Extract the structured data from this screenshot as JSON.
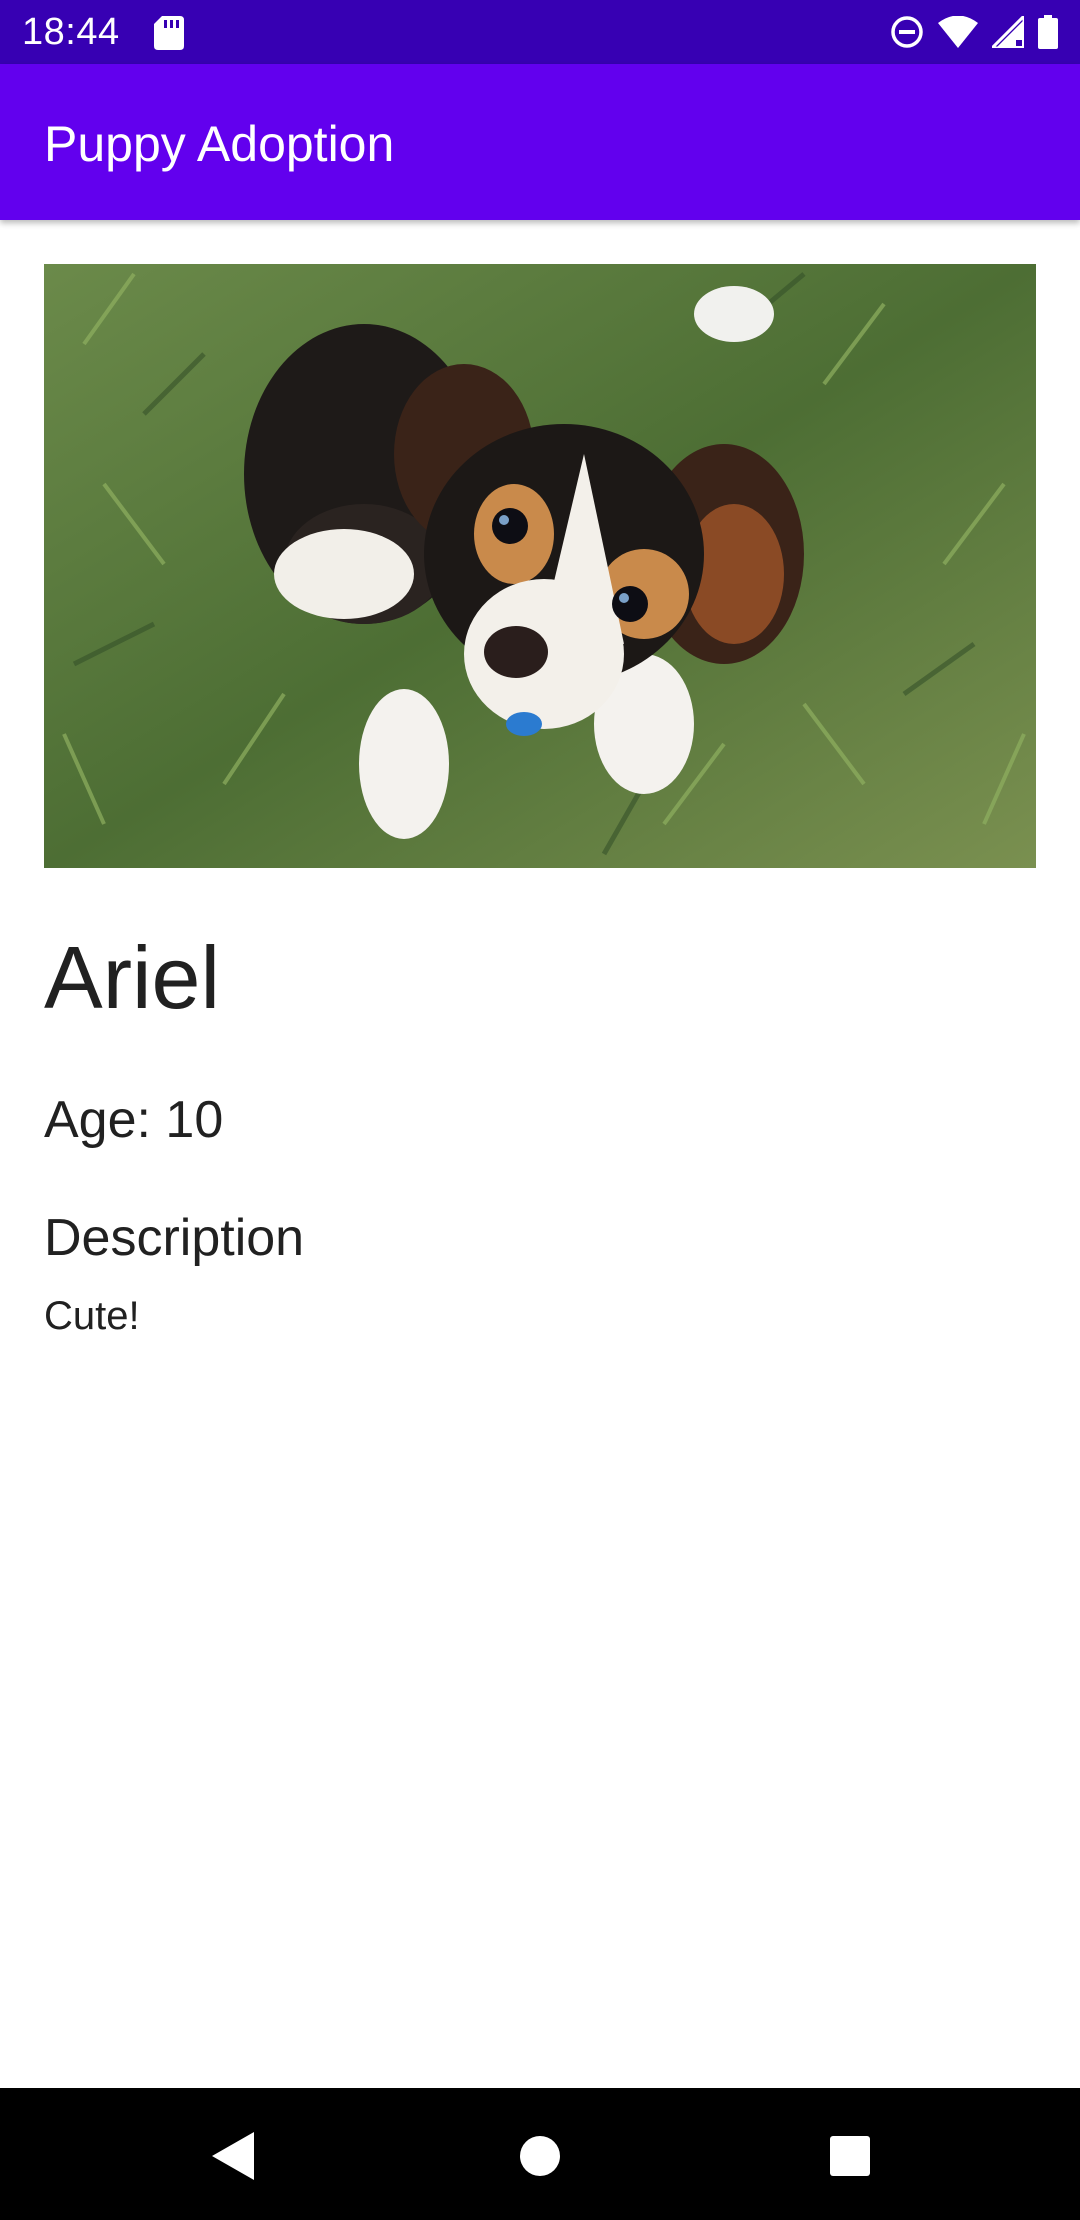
{
  "status_bar": {
    "time": "18:44",
    "icons": [
      "sd-card-icon",
      "do-not-disturb-icon",
      "wifi-icon",
      "cell-signal-icon",
      "battery-icon"
    ],
    "background": "#3700b3"
  },
  "app_bar": {
    "title": "Puppy Adoption",
    "background": "#6200ee"
  },
  "puppy": {
    "photo_icon": "puppy-photo",
    "name": "Ariel",
    "age": "Age: 10",
    "description_heading": "Description",
    "description": "Cute!"
  },
  "nav_bar": {
    "buttons": [
      "back-icon",
      "home-icon",
      "recents-icon"
    ]
  }
}
